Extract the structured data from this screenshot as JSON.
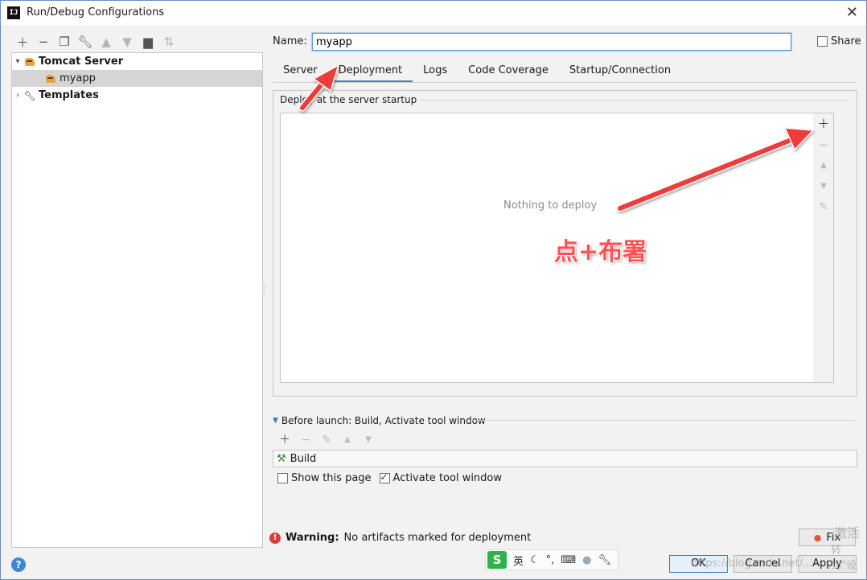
{
  "window": {
    "title": "Run/Debug Configurations",
    "app_icon": "IJ"
  },
  "left_toolbar": {
    "icons": [
      "add-icon",
      "remove-icon",
      "copy-icon",
      "wrench-icon",
      "move-up-icon",
      "move-down-icon",
      "folder-icon",
      "sort-icon"
    ]
  },
  "tree": {
    "items": [
      {
        "label": "Tomcat Server",
        "expanded": true,
        "bold": true
      },
      {
        "label": "myapp",
        "selected": true
      },
      {
        "label": "Templates",
        "expanded": false,
        "bold": true
      }
    ]
  },
  "config": {
    "name_label": "Name:",
    "name_value": "myapp",
    "share_label": "Share",
    "share_checked": false
  },
  "tabs": [
    {
      "label": "Server"
    },
    {
      "label": "Deployment",
      "active": true
    },
    {
      "label": "Logs"
    },
    {
      "label": "Code Coverage"
    },
    {
      "label": "Startup/Connection"
    }
  ],
  "deployment": {
    "group_title": "Deploy at the server startup",
    "empty_text": "Nothing to deploy",
    "side_buttons": [
      "add-icon",
      "remove-icon",
      "move-up-icon",
      "move-down-icon",
      "edit-icon"
    ]
  },
  "annotation": {
    "text": "点+布署",
    "color": "#ff4b4b"
  },
  "before_launch": {
    "title": "Before launch: Build, Activate tool window",
    "tasks": [
      {
        "label": "Build"
      }
    ],
    "show_page_label": "Show this page",
    "show_page_checked": false,
    "activate_label": "Activate tool window",
    "activate_checked": true
  },
  "warning": {
    "prefix": "Warning:",
    "text": "No artifacts marked for deployment",
    "fix_label": "Fix"
  },
  "buttons": {
    "ok": "OK",
    "cancel": "Cancel",
    "apply": "Apply",
    "help": "?"
  },
  "ime_bar": {
    "logo": "S",
    "mode": "英",
    "items": [
      "moon-icon",
      "punctuation-icon",
      "keyboard-icon",
      "user-icon",
      "wrench-icon"
    ]
  },
  "watermark": {
    "line1": "激活",
    "line2": "转到\"设",
    "url": "https://blog.csdn.net/..."
  }
}
